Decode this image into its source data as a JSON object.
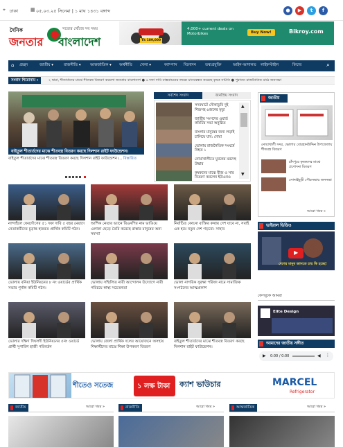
{
  "topbar": {
    "location": "ঢাকা",
    "date": "০৫.০৩.২৫ সিনেমা | ১ মাঘ ১৪৩১ বঙ্গাব্দ"
  },
  "social": [
    {
      "name": "flickr-icon",
      "glyph": "●",
      "color": "#2d5aa8"
    },
    {
      "name": "youtube-icon",
      "glyph": "▶",
      "color": "#d8332a"
    },
    {
      "name": "twitter-icon",
      "glyph": "t",
      "color": "#2d9fe0"
    },
    {
      "name": "facebook-icon",
      "glyph": "f",
      "color": "#2a5ba8"
    }
  ],
  "logo": {
    "small": "দৈনিক",
    "main1": "জনতার",
    "main2": "বাংলাদেশ",
    "tagline": "সত্যের খোঁজে সব সময়"
  },
  "top_ad": {
    "price": "Tk 189,000",
    "text": "4,000+ current deals on Motorbikes",
    "button": "Buy Now!",
    "brand": "Bikroy.com"
  },
  "nav": {
    "items": [
      "প্রচ্ছদ",
      "জাতীয় ▾",
      "রাজনীতি ▾",
      "আন্তর্জাতিক ▾",
      "অর্থনীতি",
      "খেলা ▾",
      "ক্যাম্পাস",
      "বিনোদন",
      "তথ্যপ্রযুক্তি",
      "আইন-আদালত",
      "লাইফস্টাইল",
      "ফিচার"
    ],
    "search_icon": "⌕"
  },
  "ticker": {
    "label": "সংবাদ শিরোনাম :",
    "text": "২ দ্বারা, শীতার্তদের মাঝে শীতবস্ত্র বিতরণ করলো জনতার বাংলাদেশ   ●  ৬ দফা দাবি বাস্তবায়নের লক্ষ্যে মানববন্ধন করেছে কৃষক সমিতি  ●  পুরাতন রাজনৈতিক মাঠে জনসভা"
  },
  "hero": {
    "headline": "বাইতুল শীতার্তদের মাঝে শীতবস্ত্র বিতরণ করছে দিলশান রাইট ফাউন্ডেশন।",
    "excerpt": "বাইতুল শীতার্তদের মাঝে শীতবস্ত্র বিতরণ করছে দিলশান রাইট ফাউন্ডেশন।...",
    "more": "বিস্তারিত"
  },
  "tabs": {
    "latest": "সর্বশেষ সংবাদ",
    "popular": "জনপ্রিয় সংবাদ"
  },
  "latest_list": [
    "সদরঘাটে নৌকাডুবি দুই শিশুসহ ৬জনের মৃত্যু",
    "জাতীয় সংসদের ওয়ার্ড কমিটির সভা অনুষ্ঠিত",
    "বাংলার মানুষের জন্য লড়াই চালিয়ে যাব: দোয়া",
    "ভোলায় রাজনৈতিক সংঘর্ষে নিহত ১",
    "নোয়াখালীতে যুবকের মরদেহ উদ্ধার",
    "কৃষকদের মাঝে বীজ ও সার বিতরণ করলেন ইউএনও"
  ],
  "cards": [
    "নান্দাইলে ফেরদৌসের ৫১ দফা দাবি ৫ বছর মেয়াদে নেতাকর্মীদের চূড়ান্ত হজরত প্রার্থিক কমিটি গঠন।",
    "আশিক নেতার ভ্যানে বিএনপির নাম ভাঙিয়ে এলাকা ছেড়ে তৈরি করেছে রাস্তার মানুষের অন্য সমস্যা",
    "নির্বাচিত কোনো ব্যক্তির কথায় দেশ যাবে না, সবাই এক হয়ে নতুন দেশ গড়বো: সাহাব",
    "ভোলায় বনিয়া ইউনিয়নের ৮ নং ওয়ার্ডের প্রার্থিক সভার পূর্নাঙ্গ কমিটি গঠন।",
    "ভোলায় সম্মিলিত নারী আন্দোলন উদ্যোগে নারী পরিচয়ে স্বাস্থ্য সচেতনতা",
    "ভোলা নাগরিক সুরক্ষা পরিষদ নামে সামাজিক সংগঠনের আত্মপ্রকাশ",
    "ভোলার দক্ষিণ দিঘলদী ইউনিয়নের ৫নং ওয়ার্ডে প্রার্থী সুপারিশ হাজী পরিবর্তন",
    "ভোলায় জেলা প্রার্থিক দলের আয়োজনে অসহায় শিক্ষার্থীদের মাঝে শিক্ষা উপকরণ বিতরণ",
    "বাইতুল শীতার্তদের মাঝে শীতবস্ত্র বিতরণ করছে দিলশান রাইট ফাউন্ডেশন।"
  ],
  "sidebar": {
    "box1_head": "জাতীয়",
    "box1_items": [
      "নোয়াখালী সদর, ভোলার বোরহানউদ্দিন উপজেলায় শীতবস্ত্র বিতরণ",
      "চাঁদপুরে কৃষকদের মাঝে প্রণোদনা বিতরণ",
      "সোনাইমুড়ী পৌরসভায় জনসভা"
    ],
    "box1_more": "আরো খবর »",
    "video_head": "ভাইরাল ভিডিও",
    "video_caption": "দেশের মানুষ জানতে চায় কি হচ্ছে!",
    "fb_head": "ফেসবুকে আমরা",
    "fb_title": "Elite Design",
    "radio_head": "আমাদের জাতীয় সঙ্গীত",
    "audio_time": "0:00 / 0:00"
  },
  "bottom_ad": {
    "brand_left": "শীতেও সতেজ",
    "offer": "১ লক্ষ টাকা",
    "offer2": "ক্যাশ ভাউচার",
    "brand": "MARCEL",
    "brand_sub": "Refrigerator"
  },
  "sections": [
    {
      "title": "জাতীয়",
      "more": "আরো খবর »"
    },
    {
      "title": "রাজনীতি",
      "more": "আরো খবর »"
    },
    {
      "title": "আন্তর্জাতিক",
      "more": "আরো খবর »"
    }
  ]
}
